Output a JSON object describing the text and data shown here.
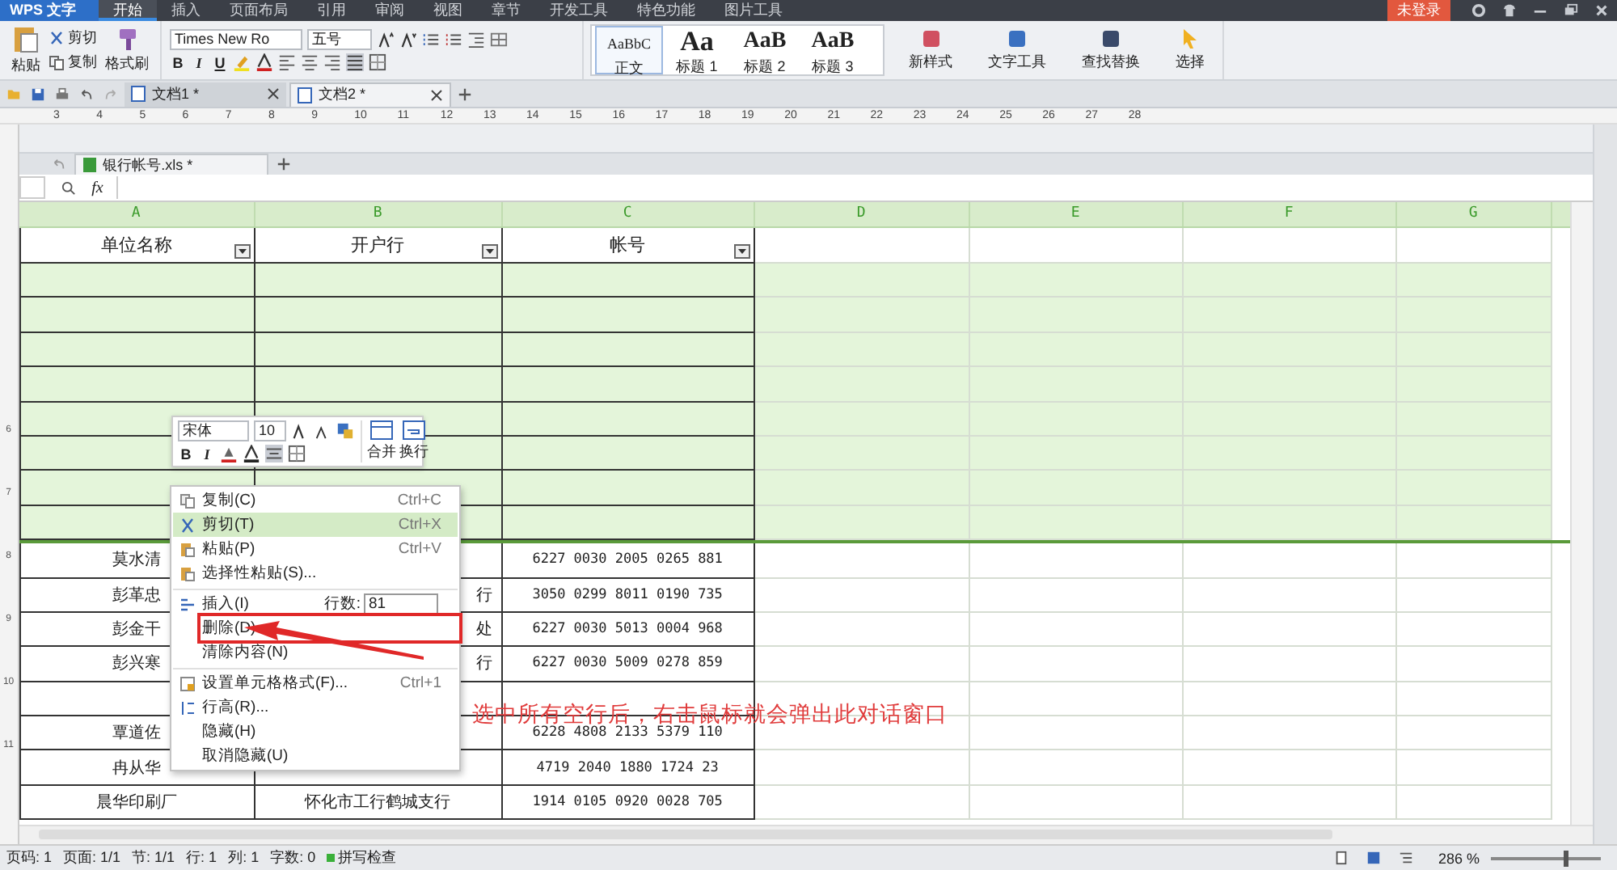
{
  "app": {
    "logo": "WPS 文字",
    "login": "未登录",
    "menu_tabs": [
      {
        "label": "开始",
        "selected": true
      },
      {
        "label": "插入",
        "selected": false
      },
      {
        "label": "页面布局",
        "selected": false
      },
      {
        "label": "引用",
        "selected": false
      },
      {
        "label": "审阅",
        "selected": false
      },
      {
        "label": "视图",
        "selected": false
      },
      {
        "label": "章节",
        "selected": false
      },
      {
        "label": "开发工具",
        "selected": false
      },
      {
        "label": "特色功能",
        "selected": false
      },
      {
        "label": "图片工具",
        "selected": false
      }
    ]
  },
  "ribbon": {
    "paste": "粘贴",
    "cut": "剪切",
    "copy": "复制",
    "format_painter": "格式刷",
    "font_name": "Times New Ro",
    "font_size": "五号",
    "text_styles": [
      "B",
      "I",
      "U"
    ],
    "style_gallery": [
      {
        "sample": "AaBbC",
        "name": "正文",
        "selected": true
      },
      {
        "sample": "Aa",
        "name": "标题 1",
        "selected": false
      },
      {
        "sample": "AaB",
        "name": "标题 2",
        "selected": false
      },
      {
        "sample": "AaB",
        "name": "标题 3",
        "selected": false
      }
    ],
    "commands": [
      "新样式",
      "文字工具",
      "查找替换",
      "选择"
    ]
  },
  "doc_tabs": [
    {
      "label": "文档1 *",
      "selected": false
    },
    {
      "label": "文档2 *",
      "selected": true
    }
  ],
  "ruler": [
    "3",
    "4",
    "5",
    "6",
    "7",
    "8",
    "9",
    "10",
    "11",
    "12",
    "13",
    "14",
    "15",
    "16",
    "17",
    "18",
    "19",
    "20",
    "21",
    "22",
    "23",
    "24",
    "25",
    "26",
    "27",
    "28"
  ],
  "vertical_ruler": [
    "6",
    "7",
    "8",
    "9",
    "10",
    "11"
  ],
  "sheet": {
    "file_tab": "银行帐号.xls *",
    "formula_label": "fx",
    "columns": [
      "A",
      "B",
      "C",
      "D",
      "E",
      "F",
      "G"
    ],
    "header": [
      "单位名称",
      "开户行",
      "帐号"
    ],
    "rows": [
      {
        "selected": true
      },
      {
        "selected": true
      },
      {
        "selected": true
      },
      {
        "selected": true
      },
      {
        "selected": true
      },
      {
        "selected": true
      },
      {
        "selected": true
      },
      {
        "selected": true
      },
      {
        "selected": false,
        "a": "莫水清",
        "c": "6227 0030 2005 0265 881"
      },
      {
        "selected": false,
        "a": "彭革忠",
        "b": "行",
        "c": "3050 0299 8011 0190 735"
      },
      {
        "selected": false,
        "a": "彭金干",
        "b": "处",
        "c": "6227 0030 5013 0004 968"
      },
      {
        "selected": false,
        "a": "彭兴寒",
        "b": "行",
        "c": "6227 0030 5009 0278 859"
      },
      {
        "selected": false
      },
      {
        "selected": false,
        "a": "覃道佐",
        "c": "6228 4808 2133 5379 110"
      },
      {
        "selected": false,
        "a": "冉从华",
        "c": "4719 2040 1880 1724 23"
      },
      {
        "selected": false,
        "a": "晨华印刷厂",
        "b": "怀化市工行鹤城支行",
        "c": "1914 0105 0920 0028 705"
      }
    ]
  },
  "mini_toolbar": {
    "font": "宋体",
    "size": "10",
    "text_styles": [
      "B",
      "I"
    ],
    "merge": "合并",
    "wrap": "换行"
  },
  "context_menu": [
    {
      "label": "复制(C)",
      "shortcut": "Ctrl+C",
      "highlighted": false,
      "marked": false,
      "separator_before": false
    },
    {
      "label": "剪切(T)",
      "shortcut": "Ctrl+X",
      "highlighted": true,
      "marked": false,
      "separator_before": false
    },
    {
      "label": "粘贴(P)",
      "shortcut": "Ctrl+V",
      "highlighted": false,
      "marked": false,
      "separator_before": false
    },
    {
      "label": "选择性粘贴(S)...",
      "highlighted": false,
      "marked": false,
      "separator_before": false
    },
    {
      "label": "插入(I)",
      "spinner_label": "行数:",
      "spinner_value": "81",
      "highlighted": false,
      "marked": false,
      "separator_before": true
    },
    {
      "label": "删除(D)",
      "highlighted": false,
      "marked": true,
      "separator_before": false
    },
    {
      "label": "清除内容(N)",
      "highlighted": false,
      "marked": false,
      "separator_before": false
    },
    {
      "label": "设置单元格格式(F)...",
      "shortcut": "Ctrl+1",
      "highlighted": false,
      "marked": false,
      "separator_before": true
    },
    {
      "label": "行高(R)...",
      "highlighted": false,
      "marked": false,
      "separator_before": false
    },
    {
      "label": "隐藏(H)",
      "highlighted": false,
      "marked": false,
      "separator_before": false
    },
    {
      "label": "取消隐藏(U)",
      "highlighted": false,
      "marked": false,
      "separator_before": false
    }
  ],
  "annotation": "选中所有空行后，右击鼠标就会弹出此对话窗口",
  "status_bar": {
    "items": [
      "页码: 1",
      "页面: 1/1",
      "节: 1/1",
      "行: 1",
      "列: 1",
      "字数: 0"
    ],
    "spell_check": "拼写检查",
    "zoom": "286 %",
    "zoom_slider": {
      "level": 0.68
    }
  }
}
